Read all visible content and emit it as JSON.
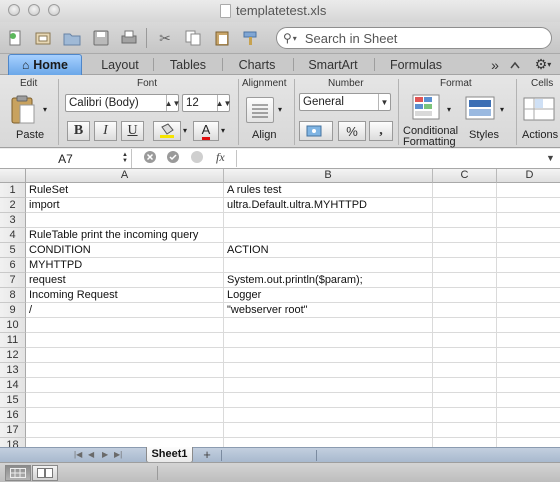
{
  "window": {
    "title": "templatetest.xls"
  },
  "toolbar": {
    "search_placeholder": "Search in Sheet"
  },
  "ribbon": {
    "tabs": [
      "Home",
      "Layout",
      "Tables",
      "Charts",
      "SmartArt",
      "Formulas"
    ],
    "tabs_overflow": "»",
    "groups": {
      "edit": "Edit",
      "font": "Font",
      "alignment": "Alignment",
      "number": "Number",
      "format": "Format",
      "cells": "Cells"
    },
    "paste_label": "Paste",
    "font_name": "Calibri (Body)",
    "font_size": "12",
    "bold": "B",
    "italic": "I",
    "underline": "U",
    "font_color": "A",
    "align_label": "Align",
    "number_format": "General",
    "percent": "%",
    "comma": ",",
    "conditional_line1": "Conditional",
    "conditional_line2": "Formatting",
    "styles_label": "Styles",
    "actions_label": "Actions"
  },
  "formula_bar": {
    "name_box": "A7",
    "fx": "fx",
    "formula": ""
  },
  "grid": {
    "columns": [
      "A",
      "B",
      "C",
      "D"
    ],
    "rows": [
      {
        "num": "1",
        "a": "RuleSet",
        "b": "A rules test"
      },
      {
        "num": "2",
        "a": "import",
        "b": "ultra.Default.ultra.MYHTTPD"
      },
      {
        "num": "3",
        "a": "",
        "b": ""
      },
      {
        "num": "4",
        "a": "RuleTable print the incoming query",
        "b": ""
      },
      {
        "num": "5",
        "a": "CONDITION",
        "b": "ACTION"
      },
      {
        "num": "6",
        "a": "MYHTTPD",
        "b": ""
      },
      {
        "num": "7",
        "a": "request",
        "b": "System.out.println($param);"
      },
      {
        "num": "8",
        "a": "Incoming Request",
        "b": "Logger"
      },
      {
        "num": "9",
        "a": "/",
        "b": "\"webserver root\""
      },
      {
        "num": "10",
        "a": "",
        "b": ""
      },
      {
        "num": "11",
        "a": "",
        "b": ""
      },
      {
        "num": "12",
        "a": "",
        "b": ""
      },
      {
        "num": "13",
        "a": "",
        "b": ""
      },
      {
        "num": "14",
        "a": "",
        "b": ""
      },
      {
        "num": "15",
        "a": "",
        "b": ""
      },
      {
        "num": "16",
        "a": "",
        "b": ""
      },
      {
        "num": "17",
        "a": "",
        "b": ""
      },
      {
        "num": "18",
        "a": "",
        "b": ""
      }
    ]
  },
  "sheets": {
    "active": "Sheet1",
    "add": "+"
  },
  "colors": {
    "tab_active": "#6aa7e8",
    "sheet_bar": "#a8b9ce",
    "font_color_underline": "#e01010",
    "highlight_fill": "#f5e400"
  }
}
